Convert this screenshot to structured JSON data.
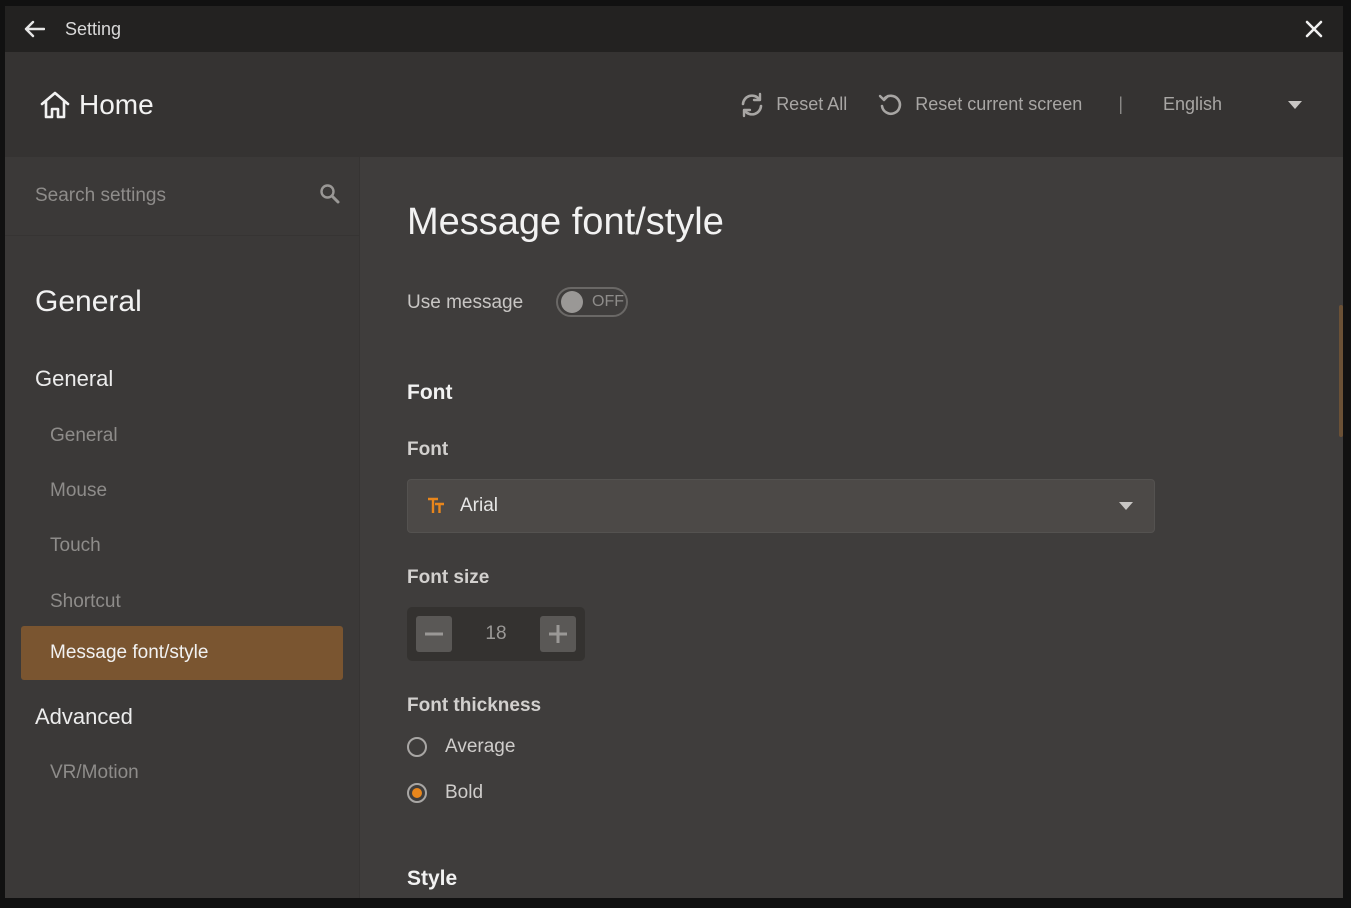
{
  "titlebar": {
    "title": "Setting",
    "back_icon": "arrow-left-icon",
    "close_icon": "close-icon"
  },
  "header": {
    "home_label": "Home",
    "reset_all_label": "Reset All",
    "reset_current_label": "Reset current screen",
    "separator": "|",
    "language": "English"
  },
  "sidebar": {
    "search_placeholder": "Search settings",
    "title": "General",
    "groups": [
      {
        "label": "General",
        "items": [
          "General",
          "Mouse",
          "Touch",
          "Shortcut",
          "Message font/style"
        ]
      },
      {
        "label": "Advanced",
        "items": [
          "VR/Motion"
        ]
      }
    ],
    "active_item": "Message font/style"
  },
  "main": {
    "title": "Message font/style",
    "use_message_label": "Use message",
    "use_message_state": "OFF",
    "font_section": "Font",
    "font_label": "Font",
    "font_value": "Arial",
    "font_size_label": "Font size",
    "font_size_value": "18",
    "font_thickness_label": "Font thickness",
    "thickness_options": [
      "Average",
      "Bold"
    ],
    "thickness_selected": "Bold",
    "style_section": "Style"
  },
  "colors": {
    "accent": "#e8861c",
    "active_bg": "#7a5530",
    "window_bg": "#3f3d3c"
  }
}
